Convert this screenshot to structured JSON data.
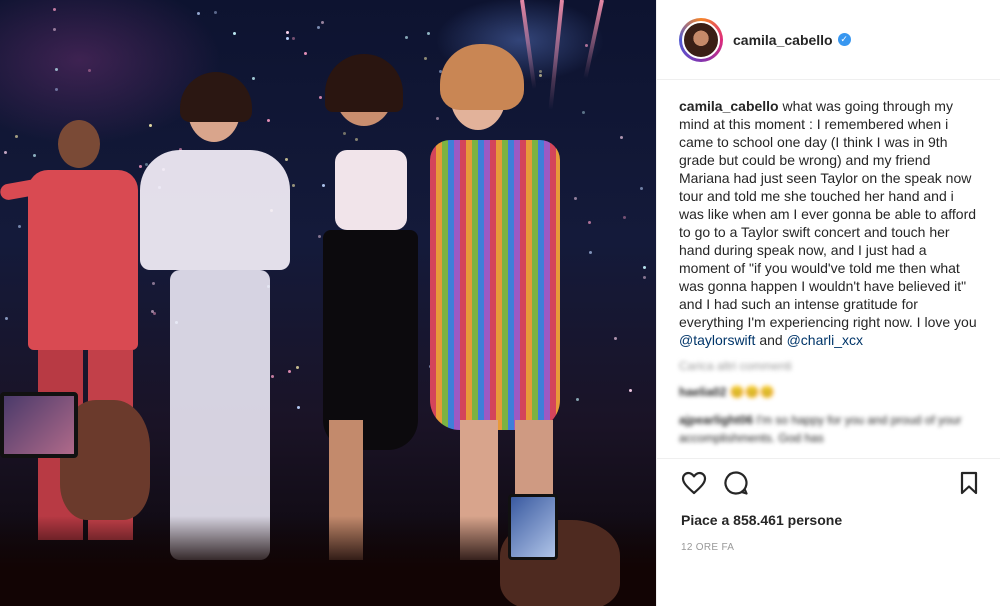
{
  "post": {
    "username": "camila_cabello",
    "verified": true,
    "caption_text": "what was going through my mind at this moment : I remembered when i came to school one day (I think I was in 9th grade but could be wrong) and my friend Mariana had just seen Taylor on the speak now tour and told me she touched her hand and i was like when am I ever gonna be able to afford to go to a Taylor swift concert and touch her hand during speak now, and I just had a moment of \"if you would've told me then what was gonna happen I wouldn't have believed it\" and I had such an intense gratitude for everything I'm experiencing right now. I love you",
    "mention_1": "@taylorswift",
    "connector": "and",
    "mention_2": "@charli_xcx",
    "load_more": "Carica altri commenti",
    "comments": [
      {
        "user": "haelia02",
        "text": "😊😊😊"
      },
      {
        "user": "ajpearlight06",
        "text": "I'm so happy for you and proud of your accomplishments. God has"
      }
    ],
    "likes_text": "Piace a 858.461 persone",
    "timestamp": "12 ORE FA"
  },
  "icons": {
    "like": "heart-icon",
    "comment": "comment-bubble-icon",
    "save": "bookmark-icon",
    "verified": "verified-badge-icon"
  },
  "colors": {
    "verified_blue": "#3897f0",
    "mention_blue": "#003569",
    "muted_gray": "#999999",
    "divider": "#efefef"
  }
}
